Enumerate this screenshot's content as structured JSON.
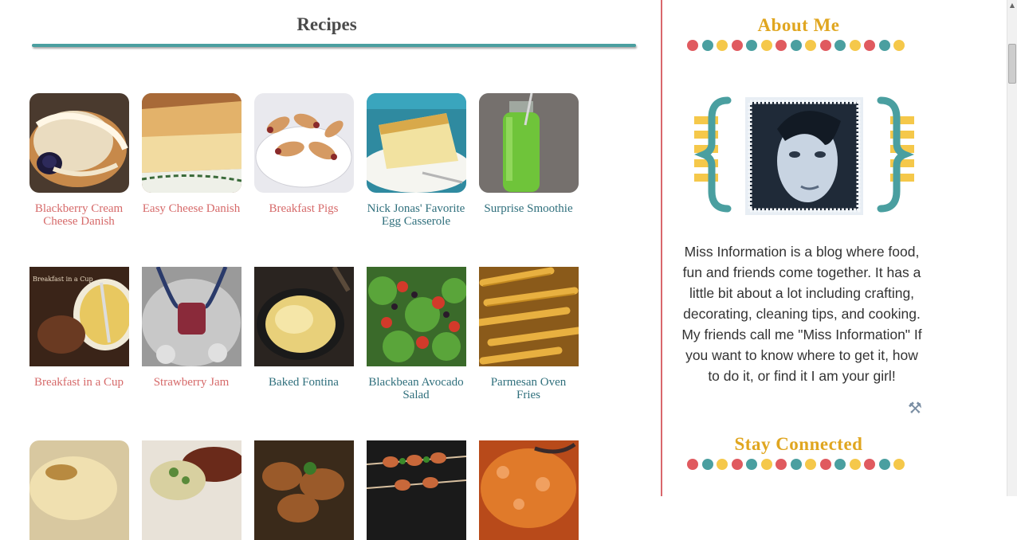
{
  "main": {
    "title": "Recipes",
    "recipes": [
      {
        "label": "Blackberry Cream Cheese Danish",
        "color": "#d66a6a",
        "image": "blackberry-danish-photo"
      },
      {
        "label": "Easy Cheese Danish",
        "color": "#d66a6a",
        "image": "cheese-danish-photo"
      },
      {
        "label": "Breakfast Pigs",
        "color": "#d66a6a",
        "image": "breakfast-pigs-photo"
      },
      {
        "label": "Nick Jonas' Favorite Egg Casserole",
        "color": "#2f6f7c",
        "image": "egg-casserole-photo"
      },
      {
        "label": "Surprise Smoothie",
        "color": "#2f6f7c",
        "image": "green-smoothie-photo"
      },
      {
        "label": "Breakfast in a Cup",
        "color": "#d66a6a",
        "image": "breakfast-cup-photo"
      },
      {
        "label": "Strawberry Jam",
        "color": "#d66a6a",
        "image": "strawberry-jam-photo"
      },
      {
        "label": "Baked Fontina",
        "color": "#2f6f7c",
        "image": "baked-fontina-photo"
      },
      {
        "label": "Blackbean Avocado Salad",
        "color": "#2f6f7c",
        "image": "avocado-salad-photo"
      },
      {
        "label": "Parmesan Oven Fries",
        "color": "#2f6f7c",
        "image": "oven-fries-photo"
      },
      {
        "label": "",
        "color": "#d66a6a",
        "image": "casserole-photo"
      },
      {
        "label": "",
        "color": "#d66a6a",
        "image": "steak-plate-photo"
      },
      {
        "label": "",
        "color": "#2f6f7c",
        "image": "chicken-wings-photo"
      },
      {
        "label": "",
        "color": "#2f6f7c",
        "image": "skewers-photo"
      },
      {
        "label": "",
        "color": "#2f6f7c",
        "image": "soup-photo"
      }
    ]
  },
  "sidebar": {
    "about_title": "About Me",
    "about_text": "Miss Information is a blog where food, fun and friends come together. It has a little bit about a lot including crafting, decorating, cleaning tips, and cooking. My friends call me \"Miss Information\" If you want to know where to get it, how to do it, or find it I am your girl!",
    "stay_title": "Stay Connected",
    "profile_image": "profile-photo-blue-tint"
  },
  "colors": {
    "teal": "#4a9fa0",
    "coral": "#e05a5f",
    "yellow": "#f5c84a",
    "gold_heading": "#e0a620",
    "divider": "#d9676c"
  }
}
